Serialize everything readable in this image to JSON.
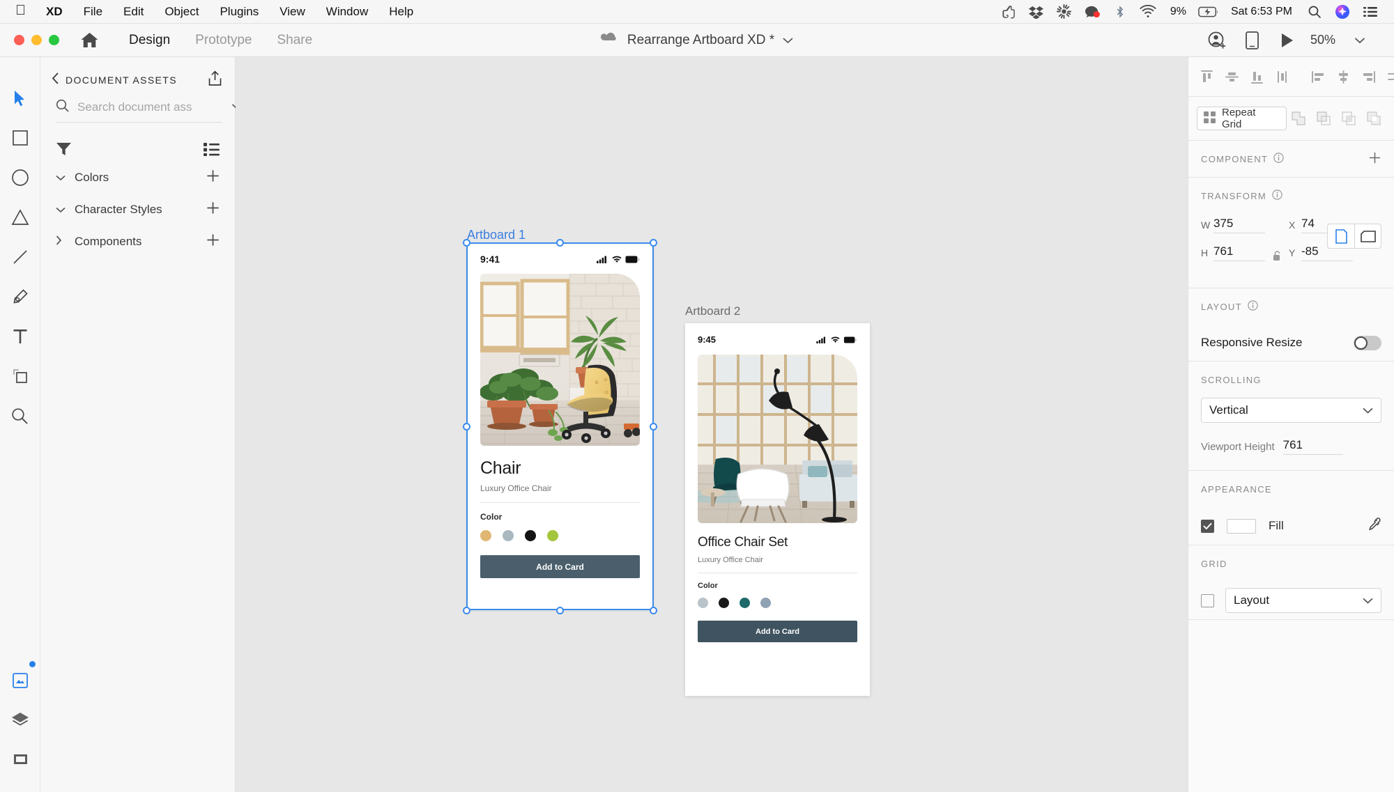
{
  "menubar": {
    "apple": "&#63743;",
    "items": [
      "XD",
      "File",
      "Edit",
      "Object",
      "Plugins",
      "View",
      "Window",
      "Help"
    ],
    "status_icons": [
      "evernote-icon",
      "dropbox-icon",
      "sunburst-icon",
      "recording-icon",
      "bluetooth-icon",
      "wifi-icon"
    ],
    "battery": "9%",
    "clock": "Sat 6:53 PM",
    "right_icons": [
      "spotlight-search-icon",
      "siri-icon",
      "control-center-icon"
    ]
  },
  "titlebar": {
    "modes": [
      {
        "label": "Design",
        "active": true
      },
      {
        "label": "Prototype",
        "active": false
      },
      {
        "label": "Share",
        "active": false
      }
    ],
    "document_title": "Rearrange Artboard XD *",
    "cloud_icon": "cloud-icon",
    "title_chevron": "chevron-down-icon",
    "right_icons": [
      "invite-user-icon",
      "device-preview-icon",
      "play-preview-icon"
    ],
    "zoom_level": "50%"
  },
  "toolrail": {
    "tools": [
      {
        "name": "select-tool",
        "active": true
      },
      {
        "name": "rectangle-tool",
        "active": false
      },
      {
        "name": "ellipse-tool",
        "active": false
      },
      {
        "name": "polygon-tool",
        "active": false
      },
      {
        "name": "line-tool",
        "active": false
      },
      {
        "name": "pen-tool",
        "active": false
      },
      {
        "name": "text-tool",
        "active": false
      },
      {
        "name": "artboard-tool",
        "active": false
      },
      {
        "name": "zoom-tool",
        "active": false
      }
    ],
    "bottom_tools": [
      {
        "name": "assets-panel-tool",
        "active": true
      },
      {
        "name": "layers-panel-tool",
        "active": false
      },
      {
        "name": "plugins-panel-tool",
        "active": false
      }
    ]
  },
  "assets_panel": {
    "back_icon": "chevron-left-icon",
    "title": "DOCUMENT ASSETS",
    "export_icon": "export-icon",
    "search": {
      "icon": "search-icon",
      "placeholder": "Search document ass",
      "value": "",
      "chevron": "chevron-down-icon"
    },
    "filter_icon": "filter-icon",
    "viewmode_icon": "list-view-icon",
    "sections": [
      {
        "label": "Colors",
        "expanded": true,
        "add": "+"
      },
      {
        "label": "Character Styles",
        "expanded": true,
        "add": "+"
      },
      {
        "label": "Components",
        "expanded": false,
        "add": "+"
      }
    ]
  },
  "canvas": {
    "artboards": [
      {
        "label": "Artboard 1",
        "selected": true,
        "time": "9:41",
        "product_title": "Chair",
        "product_subtitle": "Luxury Office Chair",
        "color_label": "Color",
        "swatches": [
          "#e0b772",
          "#aab8c0",
          "#141414",
          "#a4c63c"
        ],
        "cta_label": "Add to Card",
        "cta_color": "#4a5f6b"
      },
      {
        "label": "Artboard 2",
        "selected": false,
        "time": "9:45",
        "product_title": "Office Chair Set",
        "product_subtitle": "Luxury Office Chair",
        "color_label": "Color",
        "swatches": [
          "#b9c3c9",
          "#191919",
          "#1f6a6b",
          "#8ea2b4"
        ],
        "cta_label": "Add to Card",
        "cta_color": "#3f5360"
      }
    ]
  },
  "properties": {
    "align_icons": [
      "align-top-icon",
      "align-vertical-center-icon",
      "align-bottom-icon",
      "distribute-vertical-icon"
    ],
    "align_icons_2": [
      "align-left-icon",
      "align-horizontal-center-icon",
      "align-right-icon",
      "distribute-horizontal-icon"
    ],
    "repeat_grid_label": "Repeat Grid",
    "repeat_grid_icon": "repeat-grid-icon",
    "boolean_icons": [
      "add-shape-icon",
      "subtract-shape-icon",
      "intersect-shape-icon",
      "exclude-overlap-icon"
    ],
    "component": {
      "title": "COMPONENT",
      "info_icon": "info-icon",
      "add_label": "+"
    },
    "transform": {
      "title": "TRANSFORM",
      "info_icon": "info-icon",
      "w_label": "W",
      "w_value": "375",
      "h_label": "H",
      "h_value": "761",
      "x_label": "X",
      "x_value": "74",
      "y_label": "Y",
      "y_value": "-85",
      "lock_icon": "unlock-icon",
      "orientation": [
        {
          "name": "portrait-icon",
          "active": true
        },
        {
          "name": "landscape-icon",
          "active": false
        }
      ]
    },
    "layout": {
      "title": "LAYOUT",
      "info_icon": "info-icon",
      "responsive_label": "Responsive Resize",
      "responsive_on": false
    },
    "scrolling": {
      "title": "SCROLLING",
      "value": "Vertical",
      "chevron": "chevron-down-icon",
      "viewport_label": "Viewport Height",
      "viewport_value": "761"
    },
    "appearance": {
      "title": "APPEARANCE",
      "fill_checked": true,
      "fill_label": "Fill",
      "fill_color": "#ffffff",
      "eyedropper_icon": "eyedropper-icon"
    },
    "grid": {
      "title": "GRID",
      "checked": false,
      "value": "Layout",
      "chevron": "chevron-down-icon"
    }
  }
}
